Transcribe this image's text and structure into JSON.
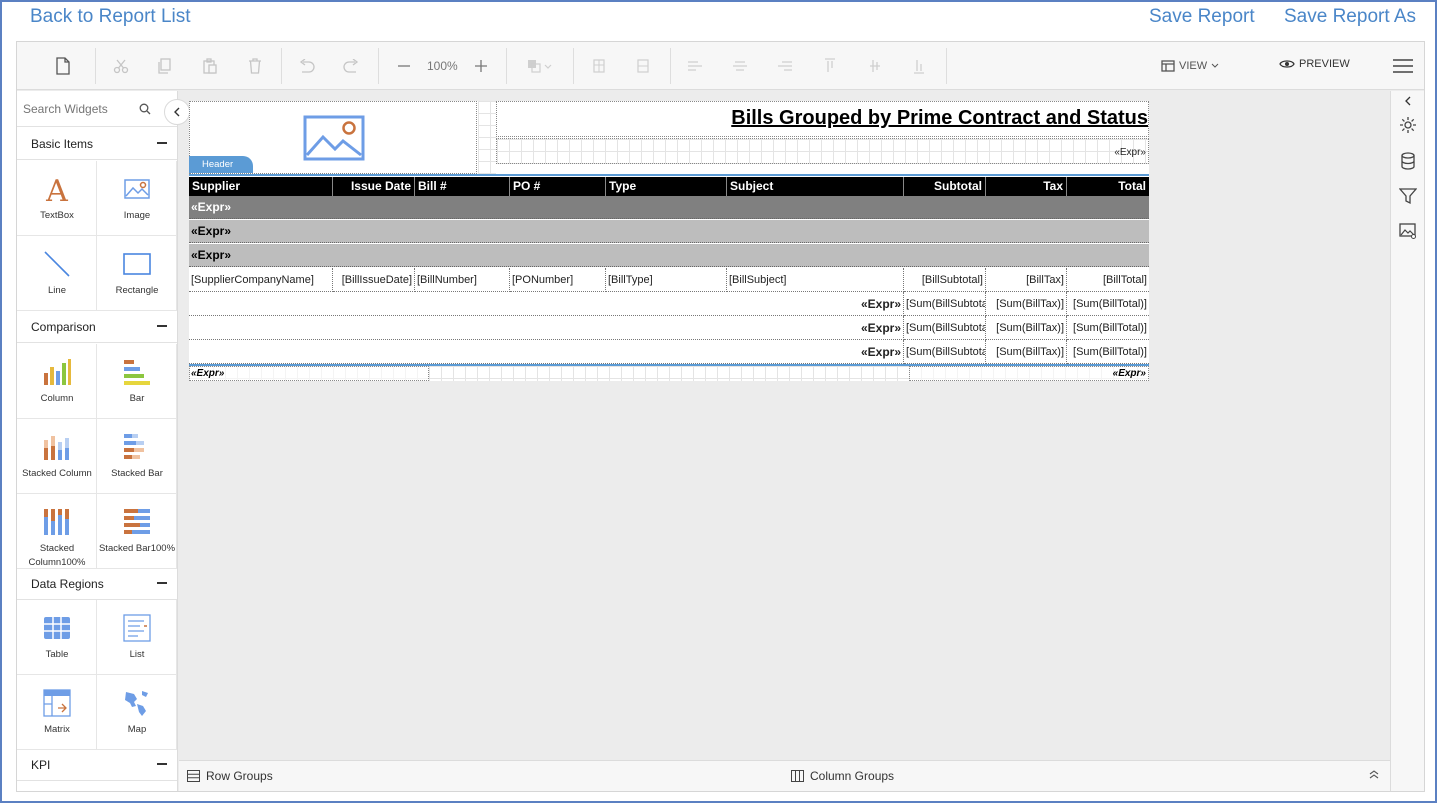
{
  "nav": {
    "back_label": "Back to Report List",
    "save_label": "Save Report",
    "save_as_label": "Save Report As"
  },
  "toolbar": {
    "zoom": "100%",
    "view_label": "VIEW",
    "preview_label": "PREVIEW"
  },
  "left_panel": {
    "search_placeholder": "Search Widgets",
    "categories": [
      {
        "title": "Basic Items",
        "items": [
          {
            "label": "TextBox",
            "icon": "textbox-icon"
          },
          {
            "label": "Image",
            "icon": "image-icon"
          },
          {
            "label": "Line",
            "icon": "line-icon"
          },
          {
            "label": "Rectangle",
            "icon": "rectangle-icon"
          }
        ]
      },
      {
        "title": "Comparison",
        "items": [
          {
            "label": "Column",
            "icon": "column-chart-icon"
          },
          {
            "label": "Bar",
            "icon": "bar-chart-icon"
          },
          {
            "label": "Stacked Column",
            "icon": "stacked-column-icon"
          },
          {
            "label": "Stacked Bar",
            "icon": "stacked-bar-icon"
          },
          {
            "label": "Stacked Column100%",
            "icon": "stacked-column100-icon"
          },
          {
            "label": "Stacked Bar100%",
            "icon": "stacked-bar100-icon"
          }
        ]
      },
      {
        "title": "Data Regions",
        "items": [
          {
            "label": "Table",
            "icon": "table-icon"
          },
          {
            "label": "List",
            "icon": "list-icon"
          },
          {
            "label": "Matrix",
            "icon": "matrix-icon"
          },
          {
            "label": "Map",
            "icon": "map-icon"
          }
        ]
      },
      {
        "title": "KPI",
        "items": []
      }
    ]
  },
  "report": {
    "title": "Bills Grouped by Prime Contract and Status",
    "header_tab": "Header",
    "header_expr": "«Expr»",
    "columns": [
      "Supplier",
      "Issue Date",
      "Bill #",
      "PO #",
      "Type",
      "Subject",
      "Subtotal",
      "Tax",
      "Total"
    ],
    "group_rows": [
      "«Expr»",
      "«Expr»",
      "«Expr»"
    ],
    "detail_row": [
      "[SupplierCompanyName]",
      "[BillIssueDate]",
      "[BillNumber]",
      "[PONumber]",
      "[BillType]",
      "[BillSubject]",
      "[BillSubtotal]",
      "[BillTax]",
      "[BillTotal]"
    ],
    "footer_rows": [
      {
        "label": "«Expr»",
        "subtotal": "[Sum(BillSubtotal)]",
        "tax": "[Sum(BillTax)]",
        "total": "[Sum(BillTotal)]"
      },
      {
        "label": "«Expr»",
        "subtotal": "[Sum(BillSubtotal)]",
        "tax": "[Sum(BillTax)]",
        "total": "[Sum(BillTotal)]"
      },
      {
        "label": "«Expr»",
        "subtotal": "[Sum(BillSubtotal)]",
        "tax": "[Sum(BillTax)]",
        "total": "[Sum(BillTotal)]"
      }
    ],
    "page_footer_left": "«Expr»",
    "page_footer_right": "«Expr»"
  },
  "bottom_bar": {
    "row_groups": "Row Groups",
    "column_groups": "Column Groups"
  },
  "colors": {
    "accent": "#4a86c8",
    "header_tab": "#5b9bd5",
    "group1": "#808080",
    "group2": "#bdbdbd"
  }
}
